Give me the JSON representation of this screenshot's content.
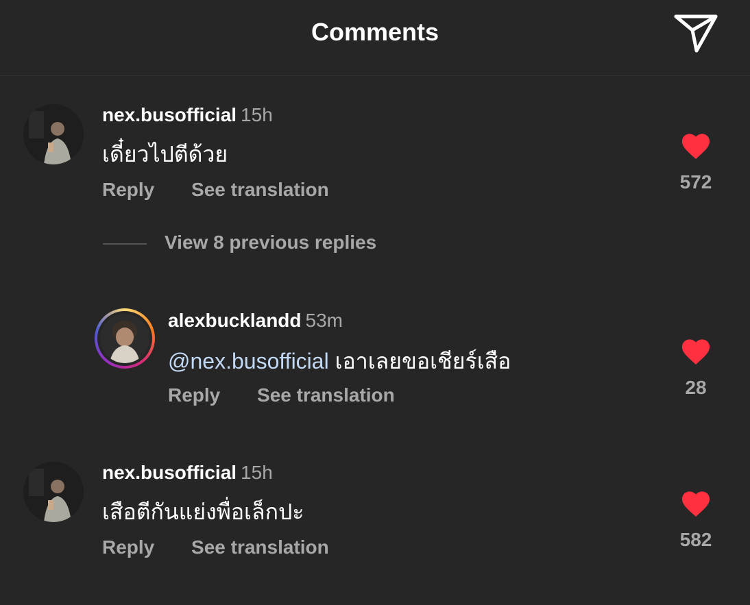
{
  "header": {
    "title": "Comments",
    "share_icon": "paper-plane-icon"
  },
  "colors": {
    "background": "#262626",
    "like": "#ff3040",
    "mention": "#c2d9f5",
    "secondary_text": "#a8a8a8"
  },
  "comments": [
    {
      "username": "nex.busofficial",
      "time": "15h",
      "text": "เดี๋ยวไปตีด้วย",
      "reply_label": "Reply",
      "translate_label": "See translation",
      "likes": "572"
    },
    {
      "username": "alexbucklandd",
      "time": "53m",
      "mention": "@nex.busofficial",
      "text": "เอาเลยขอเชียร์เสือ",
      "reply_label": "Reply",
      "translate_label": "See translation",
      "likes": "28"
    },
    {
      "username": "nex.busofficial",
      "time": "15h",
      "text": "เสือตีกันแย่งพื่อเล็กปะ",
      "reply_label": "Reply",
      "translate_label": "See translation",
      "likes": "582"
    }
  ],
  "view_replies": {
    "label": "View 8 previous replies"
  }
}
